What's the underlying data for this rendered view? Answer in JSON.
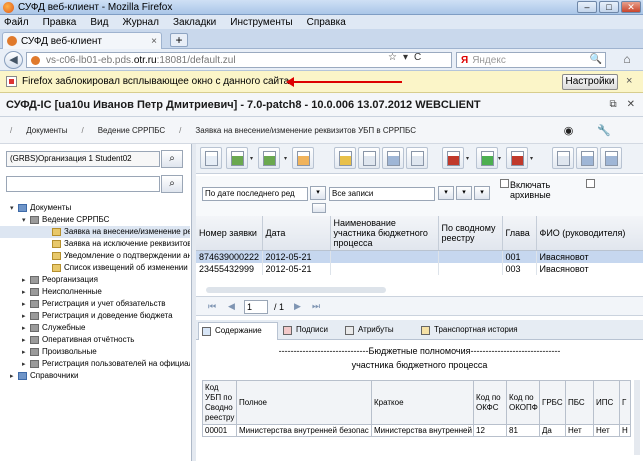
{
  "window": {
    "title": "СУФД веб-клиент - Mozilla Firefox",
    "buttons": [
      "–",
      "□",
      "✕"
    ]
  },
  "menu": [
    "Файл",
    "Правка",
    "Вид",
    "Журнал",
    "Закладки",
    "Инструменты",
    "Справка"
  ],
  "tabs": [
    {
      "label": "СУФД веб-клиент",
      "close": "×"
    }
  ],
  "newtab_label": "+",
  "nav": {
    "back": "◀",
    "url_prefix": "vs-c06-lb01-eb.pds.",
    "url_domain": "otr.ru",
    "url_suffix": ":18081/default.zul",
    "url_tools": [
      "☆",
      "▾",
      "C"
    ],
    "search_logo": "Я",
    "search_placeholder": "Яндекс",
    "search_go": "🔍",
    "home": "⌂"
  },
  "popup": {
    "message": "Firefox заблокировал всплывающее окно с данного сайта.",
    "settings_button": "Настройки",
    "close": "×"
  },
  "app": {
    "title": "СУФД-IC [ua10u Иванов Петр Дмитриевич] - 7.0-patch8 - 10.0.006 13.07.2012 WEBCLIENT",
    "header_buttons": [
      "⧉",
      "✕"
    ]
  },
  "breadcrumb": [
    "Документы",
    "Ведение СРРПБС",
    "Заявка на внесение/изменение реквизитов УБП в СРРПБС"
  ],
  "breadcrumb_sep": "/",
  "breadcrumb_icons": [
    "◉",
    "🔧"
  ],
  "left": {
    "org_value": "(GRBS)Организация 1 Student02",
    "filter_value": "",
    "search_icon_glyph": "⌕",
    "tree": [
      {
        "label": "Документы",
        "level": 0,
        "twisty": "▾",
        "icon": "blue"
      },
      {
        "label": "Ведение СРРПБС",
        "level": 1,
        "twisty": "▾",
        "icon": "gray"
      },
      {
        "label": "Заявка на внесение/изменение рекв",
        "level": 2,
        "twisty": "",
        "icon": "folder",
        "selected": true
      },
      {
        "label": "Заявка на исключение реквизитов У",
        "level": 2,
        "twisty": "",
        "icon": "folder"
      },
      {
        "label": "Уведомление о подтверждении анну",
        "level": 2,
        "twisty": "",
        "icon": "folder"
      },
      {
        "label": "Список извещений об изменении РУБ",
        "level": 2,
        "twisty": "",
        "icon": "folder"
      },
      {
        "label": "Реорганизация",
        "level": 1,
        "twisty": "▸",
        "icon": "gray"
      },
      {
        "label": "Неисполненные",
        "level": 1,
        "twisty": "▸",
        "icon": "gray"
      },
      {
        "label": "Регистрация и учет обязательств",
        "level": 1,
        "twisty": "▸",
        "icon": "gray"
      },
      {
        "label": "Регистрация и доведение бюджета",
        "level": 1,
        "twisty": "▸",
        "icon": "gray"
      },
      {
        "label": "Служебные",
        "level": 1,
        "twisty": "▸",
        "icon": "gray"
      },
      {
        "label": "Оперативная отчётность",
        "level": 1,
        "twisty": "▸",
        "icon": "gray"
      },
      {
        "label": "Произвольные",
        "level": 1,
        "twisty": "▸",
        "icon": "gray"
      },
      {
        "label": "Регистрация пользователей на официал",
        "level": 1,
        "twisty": "▸",
        "icon": "gray"
      },
      {
        "label": "Справочники",
        "level": 0,
        "twisty": "▸",
        "icon": "blue"
      }
    ]
  },
  "toolbar": {
    "caret": "▾"
  },
  "filters": {
    "sort_value": "По дате последнего ред",
    "records_value": "Все записи",
    "include_label_1": "Включать",
    "include_label_2": "архивные",
    "small_btn": "▾"
  },
  "grid": {
    "columns": [
      "Номер заявки",
      "Дата",
      "Наименование участника бюджетного процесса",
      "По сводному реестру",
      "Глава",
      "ФИО (руководителя)"
    ],
    "rows": [
      [
        "874639000222",
        "2012-05-21",
        "",
        "",
        "001",
        "Ивасяновот"
      ],
      [
        "23455432999",
        "2012-05-21",
        "",
        "",
        "003",
        "Ивасяновот"
      ]
    ],
    "selected_row": 0
  },
  "pager": {
    "first": "⏮",
    "prev": "◀",
    "page": "1",
    "total": "/ 1",
    "next": "▶",
    "last": "⏭"
  },
  "detail_tabs": [
    "Содержание",
    "Подписи",
    "Атрибуты",
    "Транспортная история"
  ],
  "content": {
    "title": "------------------------------Бюджетные полномочия------------------------------",
    "subtitle": "участника бюджетного процесса",
    "columns": [
      "Код УБП по Сводно реестру",
      "Полное",
      "Краткое",
      "Код по ОКФС",
      "Код по ОКОПФ",
      "ГРБС",
      "ПБС",
      "ИПС",
      "Г"
    ],
    "rows": [
      [
        "00001",
        "Министерства внутренней безопас",
        "Министерства внутренней",
        "12",
        "81",
        "Да",
        "Нет",
        "Нет",
        "Н"
      ]
    ]
  }
}
